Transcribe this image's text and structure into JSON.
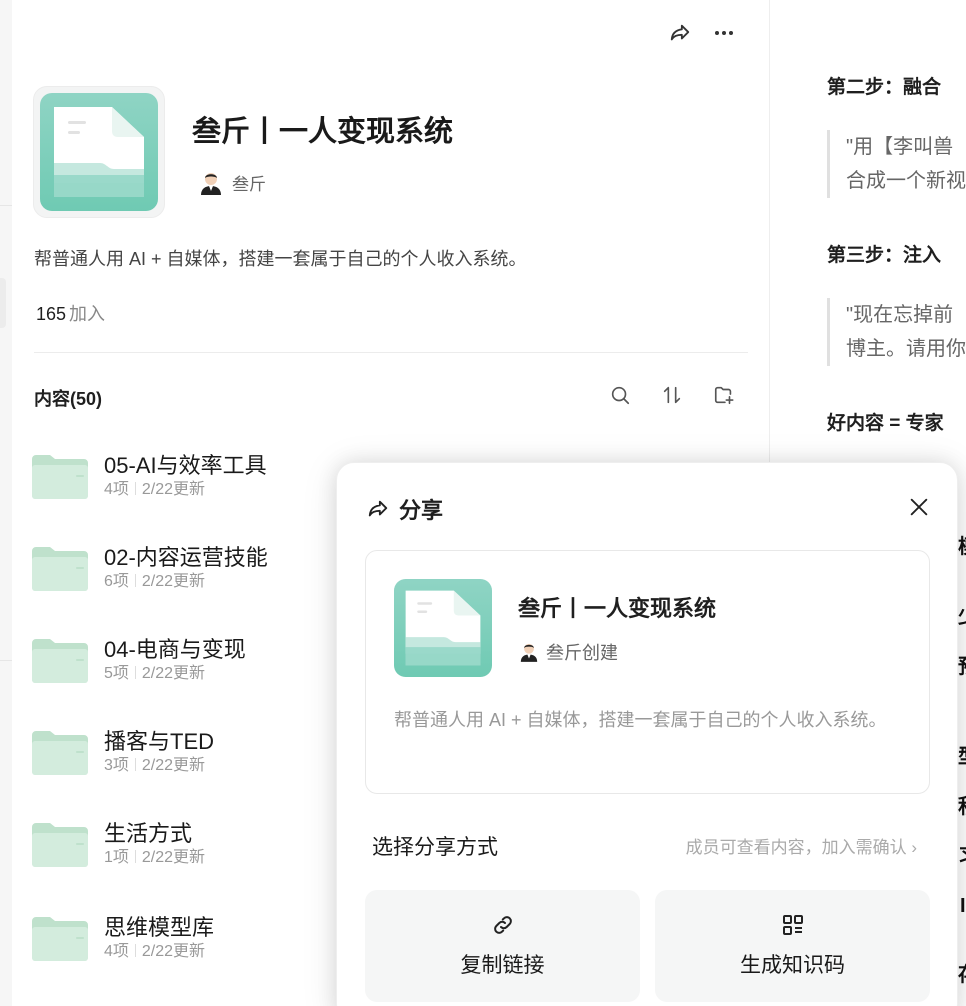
{
  "group": {
    "title": "叁斤丨一人变现系统",
    "creator": "叁斤",
    "description": "帮普通人用 AI + 自媒体，搭建一套属于自己的个人收入系统。",
    "joined_count": "165",
    "joined_label": "加入"
  },
  "content": {
    "heading": "内容(50)",
    "folders": [
      {
        "name": "05-AI与效率工具",
        "count": "4项",
        "updated": "2/22更新"
      },
      {
        "name": "02-内容运营技能",
        "count": "6项",
        "updated": "2/22更新"
      },
      {
        "name": "04-电商与变现",
        "count": "5项",
        "updated": "2/22更新"
      },
      {
        "name": "播客与TED",
        "count": "3项",
        "updated": "2/22更新"
      },
      {
        "name": "生活方式",
        "count": "1项",
        "updated": "2/22更新"
      },
      {
        "name": "思维模型库",
        "count": "4项",
        "updated": "2/22更新"
      }
    ]
  },
  "article": {
    "step2": "第二步：融合",
    "quote1_line1": "\"用【李叫兽",
    "quote1_line2": "合成一个新视",
    "step3": "第三步：注入",
    "quote2_line1": "\"现在忘掉前",
    "quote2_line2": "博主。请用你",
    "formula": "好内容 = 专家",
    "frags": [
      "模",
      "少",
      "预",
      "型",
      "积",
      "习",
      "I",
      "存"
    ]
  },
  "share": {
    "title": "分享",
    "card_title": "叁斤丨一人变现系统",
    "card_creator": "叁斤创建",
    "card_desc": "帮普通人用 AI + 自媒体，搭建一套属于自己的个人收入系统。",
    "select_label": "选择分享方式",
    "permission_hint": "成员可查看内容，加入需确认 ›",
    "copy_link": "复制链接",
    "gen_code": "生成知识码"
  },
  "icons": {
    "share": "share-icon",
    "more": "more-icon",
    "search": "search-icon",
    "sort": "sort-icon",
    "new_folder": "new-folder-icon",
    "close": "close-icon",
    "link": "link-icon",
    "qr": "qr-code-icon"
  },
  "colors": {
    "accent_teal": "#7fd1bf",
    "folder_green": "#d3ecdd"
  }
}
